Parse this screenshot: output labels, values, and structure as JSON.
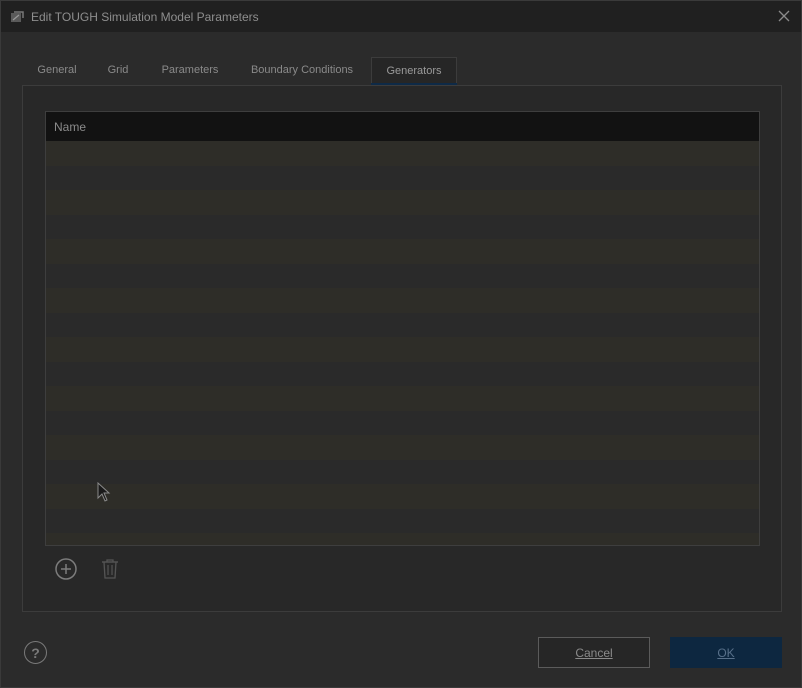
{
  "window": {
    "title": "Edit TOUGH Simulation Model Parameters",
    "app_icon": "tough-app-icon",
    "close_icon": "close-icon"
  },
  "tabs": [
    {
      "label": "General",
      "active": false
    },
    {
      "label": "Grid",
      "active": false
    },
    {
      "label": "Parameters",
      "active": false
    },
    {
      "label": "Boundary Conditions",
      "active": false
    },
    {
      "label": "Generators",
      "active": true
    }
  ],
  "table": {
    "columns": [
      "Name"
    ],
    "rows": []
  },
  "toolbar": {
    "add_icon": "add-circle-icon",
    "delete_icon": "trash-icon"
  },
  "footer": {
    "help_label": "?",
    "cancel_label": "Cancel",
    "ok_label": "OK"
  },
  "colors": {
    "accent": "#0d2740",
    "background": "#2b2b2b",
    "header": "#121212"
  }
}
